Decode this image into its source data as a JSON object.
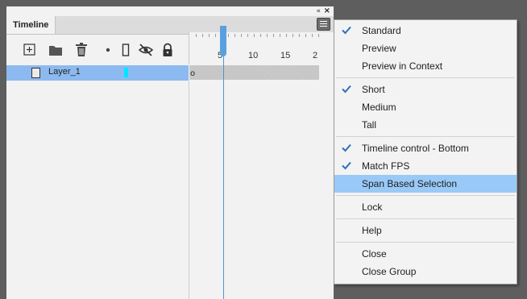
{
  "panel": {
    "tab_label": "Timeline",
    "collapse_glyph": "«",
    "close_glyph": "×",
    "menu_icon": "hamburger-menu-icon"
  },
  "toolbar": {
    "icons": [
      "new-layer-icon",
      "folder-icon",
      "trash-icon",
      "dot-icon",
      "outline-icon",
      "eye-hidden-icon",
      "lock-icon"
    ]
  },
  "ruler": {
    "labels": [
      "5",
      "10",
      "15",
      "2"
    ]
  },
  "layers": [
    {
      "name": "Layer_1",
      "color": "#00e5ff",
      "selected": true,
      "keyframe_glyph": "o"
    }
  ],
  "context_menu": {
    "items": [
      {
        "label": "Standard",
        "checked": true
      },
      {
        "label": "Preview",
        "checked": false
      },
      {
        "label": "Preview in Context",
        "checked": false
      },
      {
        "label": "Short",
        "checked": true
      },
      {
        "label": "Medium",
        "checked": false
      },
      {
        "label": "Tall",
        "checked": false
      },
      {
        "label": "Timeline control - Bottom",
        "checked": true
      },
      {
        "label": "Match FPS",
        "checked": true
      },
      {
        "label": "Span Based Selection",
        "checked": false,
        "highlighted": true
      },
      {
        "label": "Lock",
        "checked": false
      },
      {
        "label": "Help",
        "checked": false
      },
      {
        "label": "Close",
        "checked": false
      },
      {
        "label": "Close Group",
        "checked": false
      }
    ],
    "highlight_color": "#99c9f7",
    "check_color": "#2f6fbf"
  }
}
